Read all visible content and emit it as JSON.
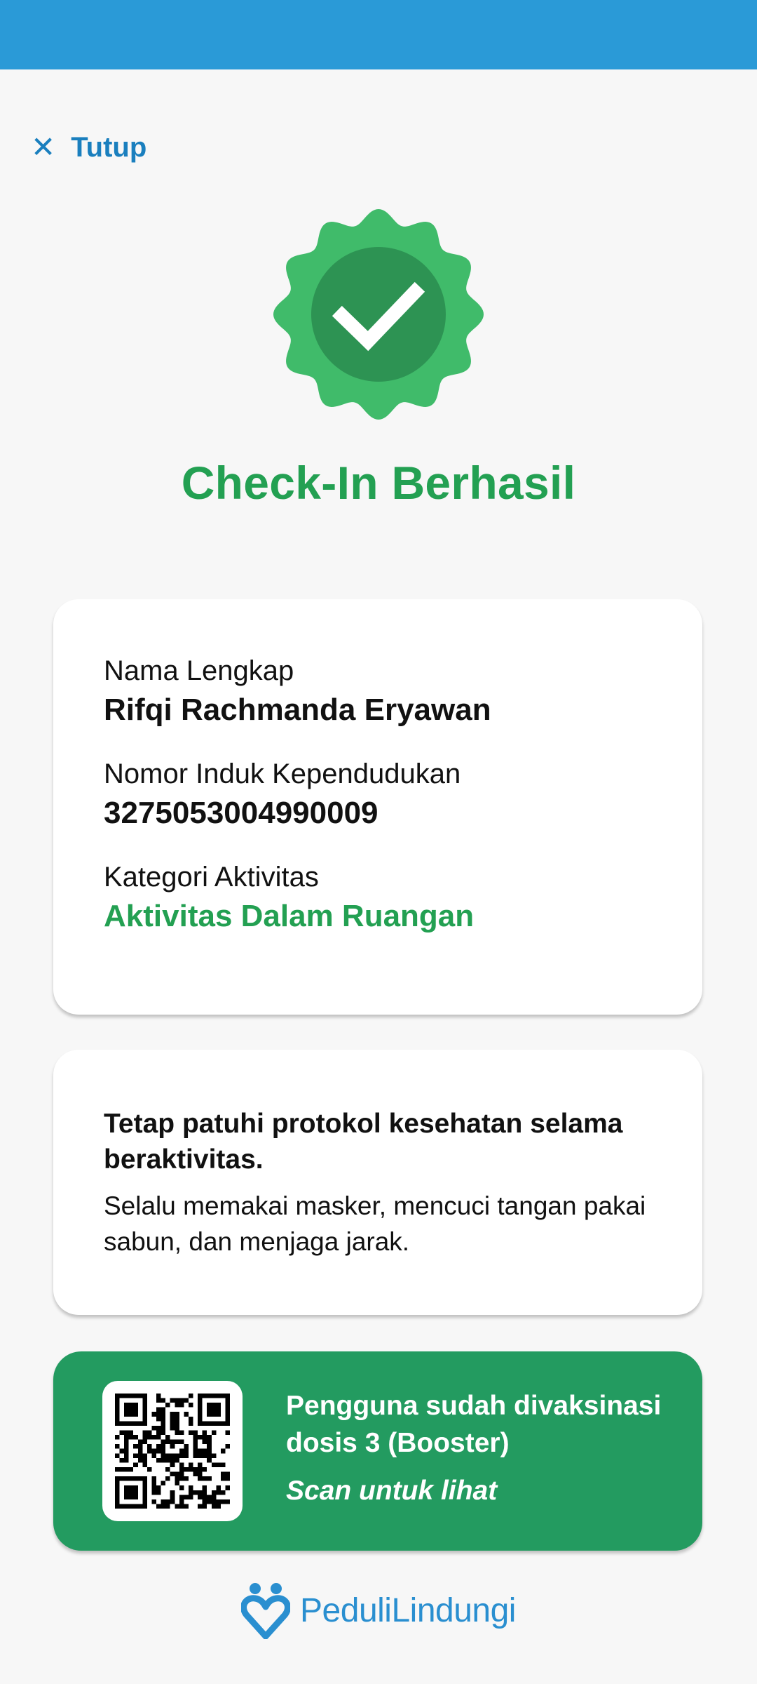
{
  "header": {
    "close_label": "Tutup",
    "close_icon": "close-icon"
  },
  "status": {
    "title": "Check-In Berhasil",
    "icon": "verified-check-badge-icon"
  },
  "info": {
    "name_label": "Nama Lengkap",
    "name_value": "Rifqi Rachmanda Eryawan",
    "nik_label": "Nomor Induk Kependudukan",
    "nik_value": "3275053004990009",
    "category_label": "Kategori Aktivitas",
    "category_value": "Aktivitas Dalam Ruangan"
  },
  "protocol": {
    "title": "Tetap patuhi protokol kesehatan selama beraktivitas.",
    "body": "Selalu memakai masker, mencuci tangan pakai sabun, dan menjaga jarak."
  },
  "vaccine": {
    "status": "Pengguna sudah divaksinasi dosis 3 (Booster)",
    "scan_label": "Scan untuk lihat",
    "icon": "qr-code-icon"
  },
  "brand": {
    "name": "PeduliLindungi",
    "icon": "pedulilindungi-logo-icon"
  },
  "colors": {
    "topbar": "#2a9ad7",
    "success_green": "#23a052",
    "badge_outer": "#40bb6a",
    "badge_inner": "#2d9353",
    "vaccine_card": "#239b60",
    "link_blue": "#1a7fbe"
  }
}
